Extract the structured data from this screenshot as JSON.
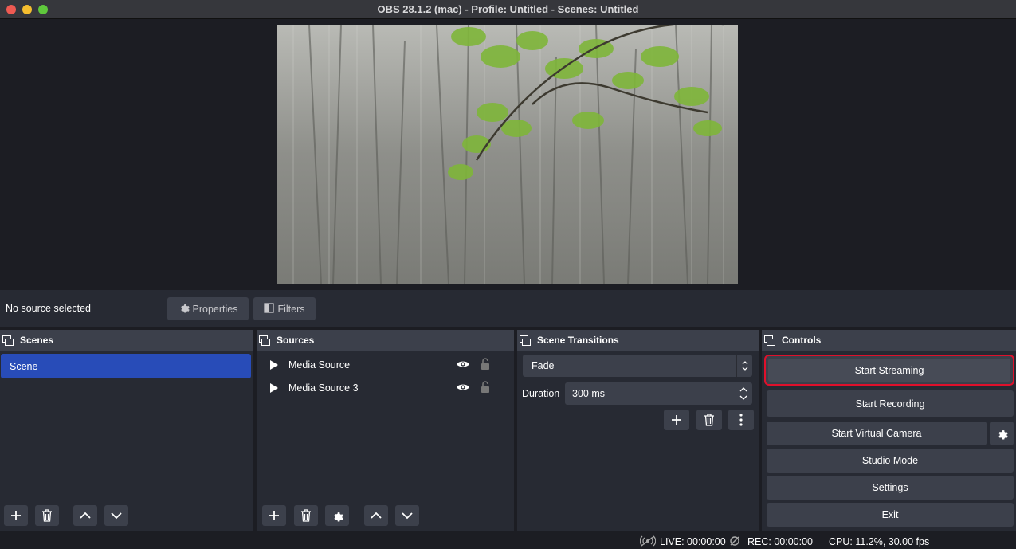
{
  "window": {
    "title": "OBS 28.1.2 (mac) - Profile: Untitled - Scenes: Untitled"
  },
  "context_bar": {
    "status": "No source selected",
    "properties_label": "Properties",
    "filters_label": "Filters"
  },
  "scenes": {
    "header": "Scenes",
    "items": [
      {
        "label": "Scene",
        "selected": true
      }
    ]
  },
  "sources": {
    "header": "Sources",
    "items": [
      {
        "label": "Media Source",
        "visible": true,
        "locked": false
      },
      {
        "label": "Media Source 3",
        "visible": true,
        "locked": false
      }
    ]
  },
  "transitions": {
    "header": "Scene Transitions",
    "selected": "Fade",
    "duration_label": "Duration",
    "duration_value": "300 ms"
  },
  "controls": {
    "header": "Controls",
    "start_streaming": "Start Streaming",
    "start_recording": "Start Recording",
    "start_virtual_camera": "Start Virtual Camera",
    "studio_mode": "Studio Mode",
    "settings": "Settings",
    "exit": "Exit",
    "highlight_color": "#e0102b"
  },
  "status_bar": {
    "live": "LIVE: 00:00:00",
    "rec": "REC: 00:00:00",
    "cpu": "CPU: 11.2%, 30.00 fps"
  },
  "colors": {
    "selected_scene": "#284cb8",
    "dock_bg": "#272a33",
    "button_bg": "#3c404b"
  }
}
